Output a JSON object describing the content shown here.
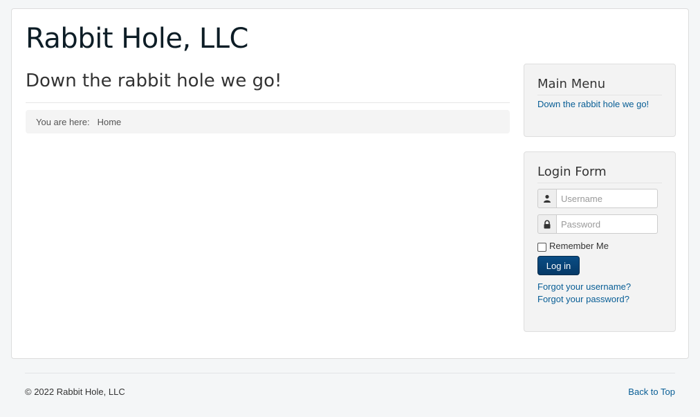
{
  "site": {
    "title": "Rabbit Hole, LLC"
  },
  "content": {
    "heading": "Down the rabbit hole we go!",
    "breadcrumb": {
      "prefix": "You are here:",
      "home": "Home"
    }
  },
  "main_menu": {
    "title": "Main Menu",
    "items": [
      {
        "label": "Down the rabbit hole we go!"
      }
    ]
  },
  "login_form": {
    "title": "Login Form",
    "username_placeholder": "Username",
    "password_placeholder": "Password",
    "username_icon": "user-icon",
    "password_icon": "lock-icon",
    "remember_label": "Remember Me",
    "remember_checked": false,
    "submit_label": "Log in",
    "forgot_username": "Forgot your username?",
    "forgot_password": "Forgot your password?"
  },
  "footer": {
    "copyright": "© 2022 Rabbit Hole, LLC",
    "back_to_top": "Back to Top"
  },
  "colors": {
    "link": "#075d95",
    "button": "#053967",
    "page_background": "#f4f6f7"
  }
}
